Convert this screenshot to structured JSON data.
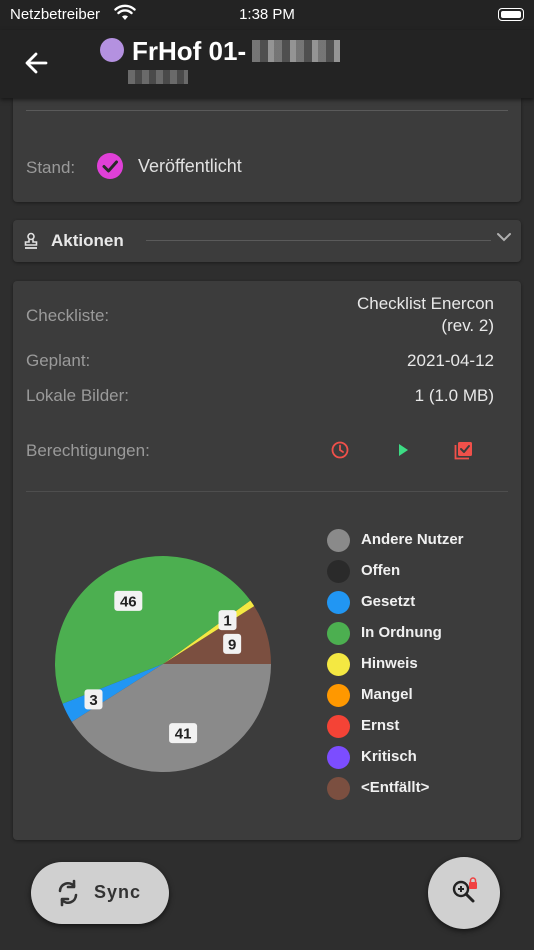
{
  "status_bar": {
    "carrier": "Netzbetreiber",
    "time": "1:38 PM"
  },
  "app_bar": {
    "title": "FrHof 01-",
    "title_dot_color": "#b491e0"
  },
  "status_card": {
    "label": "Stand:",
    "value": "Veröffentlicht",
    "check_color": "#e040d8"
  },
  "actions_section": {
    "label": "Aktionen"
  },
  "details": {
    "checklist_label": "Checkliste:",
    "checklist_value_line1": "Checklist Enercon",
    "checklist_value_line2": "(rev. 2)",
    "planned_label": "Geplant:",
    "planned_value": "2021-04-12",
    "images_label": "Lokale Bilder:",
    "images_value": "1 (1.0 MB)",
    "permissions_label": "Berechtigungen:",
    "permission_icons": [
      "clock-icon",
      "play-icon",
      "checklist-icon"
    ]
  },
  "chart_data": {
    "type": "pie",
    "slices": [
      {
        "label": "<Entfällt>",
        "value": 9,
        "color": "#7b4f40"
      },
      {
        "label": "Hinweis",
        "value": 1,
        "color": "#f4e842"
      },
      {
        "label": "In Ordnung",
        "value": 46,
        "color": "#4caf50"
      },
      {
        "label": "Gesetzt",
        "value": 3,
        "color": "#2196f3"
      },
      {
        "label": "Andere Nutzer",
        "value": 41,
        "color": "#8a8a8a"
      }
    ],
    "legend": [
      {
        "label": "Andere Nutzer",
        "color": "#8a8a8a"
      },
      {
        "label": "Offen",
        "color": "#2a2a2a"
      },
      {
        "label": "Gesetzt",
        "color": "#2196f3"
      },
      {
        "label": "In Ordnung",
        "color": "#4caf50"
      },
      {
        "label": "Hinweis",
        "color": "#f4e842"
      },
      {
        "label": "Mangel",
        "color": "#ff9800"
      },
      {
        "label": "Ernst",
        "color": "#f44336"
      },
      {
        "label": "Kritisch",
        "color": "#7c4dff"
      },
      {
        "label": "<Entfällt>",
        "color": "#7b4f40"
      }
    ],
    "legend_placement": "right"
  },
  "buttons": {
    "sync_label": "Sync"
  }
}
